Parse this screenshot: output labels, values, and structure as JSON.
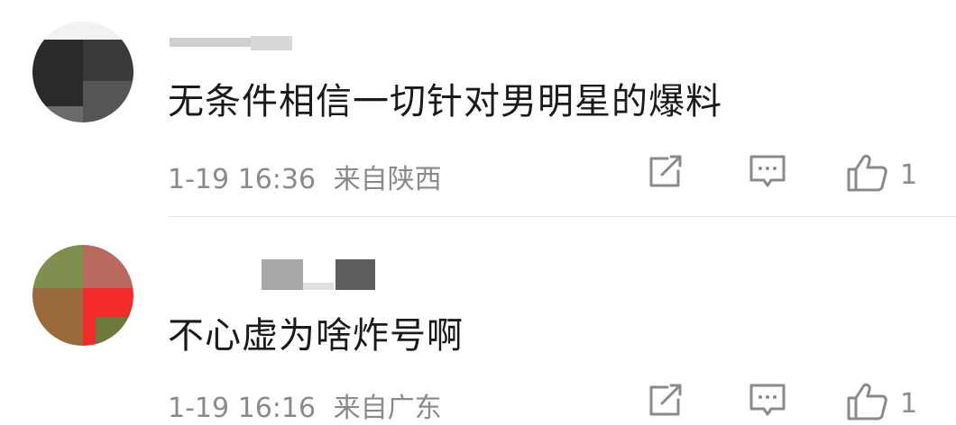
{
  "comments": [
    {
      "text": "无条件相信一切针对男明星的爆料",
      "time": "1-19 16:36",
      "location": "来自陕西",
      "likes": "1",
      "icons": [
        "share-icon",
        "reply-icon",
        "like-icon"
      ]
    },
    {
      "text": "不心虚为啥炸号啊",
      "time": "1-19 16:16",
      "location": "来自广东",
      "likes": "1",
      "icons": [
        "share-icon",
        "reply-icon",
        "like-icon"
      ]
    }
  ],
  "colors": {
    "text": "#1a1a1a",
    "meta": "#8a8a8a",
    "icon": "#8a8a8a",
    "divider": "#e6e6e6"
  }
}
